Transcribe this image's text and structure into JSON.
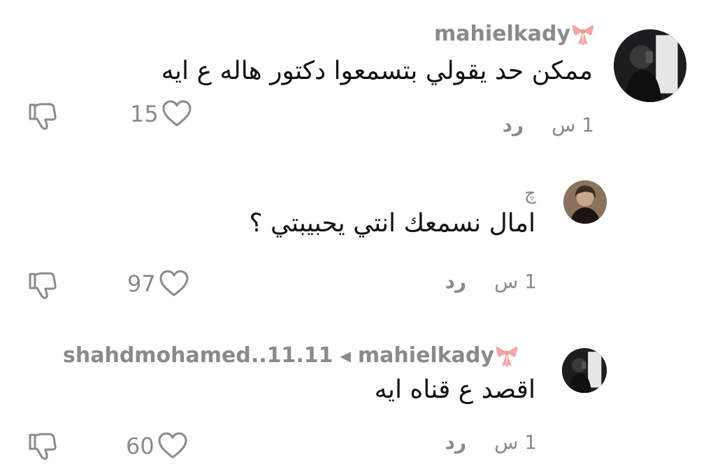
{
  "comments": [
    {
      "username": "mahielkady",
      "text": "ممكن حد يقولي بتسمعوا دكتور هاله ع ايه",
      "time": "1 س",
      "reply_label": "رد",
      "likes": "15",
      "avatar_icon": "user-photo-avatar",
      "badge_icon": "pink-bow-icon"
    },
    {
      "username": "چ",
      "text": "امال نسمعك انتي يحبيبتي ؟",
      "time": "1 س",
      "reply_label": "رد",
      "likes": "97",
      "avatar_icon": "user-photo-avatar"
    },
    {
      "reply_to_user": "shahdmohamed..11.11",
      "username": "mahielkady",
      "text": "اقصد ع قناه ايه",
      "time": "1 س",
      "reply_label": "رد",
      "likes": "60",
      "avatar_icon": "user-photo-avatar",
      "badge_icon": "pink-bow-icon"
    }
  ],
  "colors": {
    "muted": "#8a8a8a",
    "text": "#111111",
    "bow": "#f2a7a7"
  }
}
